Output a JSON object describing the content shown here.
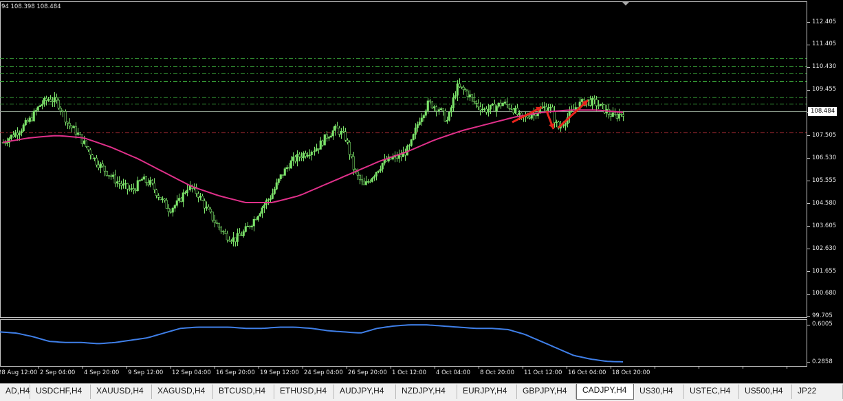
{
  "window": {
    "info_text": "94 108.398 108.484"
  },
  "price_axis": {
    "labels": [
      "112.405",
      "111.405",
      "110.430",
      "109.455",
      "108.484",
      "107.505",
      "106.530",
      "105.555",
      "104.580",
      "103.605",
      "102.630",
      "101.655",
      "100.680",
      "99.705"
    ],
    "current_price": "108.484"
  },
  "indicator_axis": {
    "top": "0.6005",
    "bottom": "0.2858"
  },
  "time_axis": {
    "labels": [
      "28 Aug 12:00",
      "2 Sep 04:00",
      "4 Sep 20:00",
      "9 Sep 12:00",
      "12 Sep 04:00",
      "16 Sep 20:00",
      "19 Sep 12:00",
      "24 Sep 04:00",
      "26 Sep 20:00",
      "1 Oct 12:00",
      "4 Oct 04:00",
      "8 Oct 20:00",
      "11 Oct 12:00",
      "16 Oct 04:00",
      "18 Oct 20:00"
    ]
  },
  "colors": {
    "candle": "#7ce36a",
    "moving_average": "#e0308a",
    "indicator_line": "#3f7fe8",
    "resistance_lines": "#3aa63a",
    "support_line": "#c0303a",
    "arrows": "#e8241c",
    "grid_frame": "#c8c8c8"
  },
  "chart_data": {
    "type": "candlestick",
    "symbol": "CADJPY",
    "timeframe": "H4",
    "ylim": [
      99.705,
      112.9
    ],
    "close_series_approx": [
      107.2,
      107.5,
      107.8,
      108.2,
      108.8,
      109.1,
      108.9,
      108.0,
      107.6,
      107.0,
      106.4,
      106.0,
      105.6,
      105.3,
      105.1,
      105.6,
      105.4,
      104.8,
      104.3,
      104.6,
      105.3,
      105.0,
      104.3,
      103.7,
      103.2,
      103.0,
      103.3,
      103.8,
      104.4,
      104.9,
      105.7,
      106.3,
      106.6,
      106.8,
      107.0,
      107.5,
      107.8,
      107.4,
      105.9,
      105.3,
      105.8,
      106.3,
      106.5,
      106.6,
      107.0,
      108.2,
      108.9,
      108.7,
      108.1,
      109.6,
      109.4,
      108.9,
      108.6,
      108.7,
      108.9,
      108.7,
      108.2,
      108.4,
      108.6,
      108.8,
      107.8,
      108.3,
      108.8,
      109.0,
      108.9,
      108.6,
      108.3,
      108.5
    ],
    "moving_average_approx": [
      107.2,
      107.4,
      107.5,
      107.4,
      107.0,
      106.5,
      105.9,
      105.3,
      104.9,
      104.6,
      104.6,
      104.9,
      105.4,
      105.9,
      106.4,
      106.8,
      107.3,
      107.7,
      108.0,
      108.3,
      108.5,
      108.6,
      108.6,
      108.5
    ],
    "horizontal_levels": {
      "resistance": [
        110.83,
        110.52,
        110.17,
        109.84,
        109.17,
        108.88
      ],
      "support": [
        107.63
      ]
    },
    "indicator": {
      "range": [
        0.2858,
        0.6005
      ],
      "values_approx": [
        0.54,
        0.53,
        0.5,
        0.46,
        0.45,
        0.45,
        0.44,
        0.45,
        0.47,
        0.49,
        0.53,
        0.57,
        0.58,
        0.58,
        0.58,
        0.57,
        0.57,
        0.58,
        0.58,
        0.57,
        0.55,
        0.54,
        0.53,
        0.57,
        0.59,
        0.6,
        0.6,
        0.59,
        0.58,
        0.57,
        0.57,
        0.56,
        0.52,
        0.46,
        0.4,
        0.34,
        0.31,
        0.29,
        0.286
      ]
    }
  },
  "tabs": [
    {
      "label": "AD,H4",
      "active": false
    },
    {
      "label": "USDCHF,H4",
      "active": false
    },
    {
      "label": "XAUUSD,H4",
      "active": false
    },
    {
      "label": "XAGUSD,H4",
      "active": false
    },
    {
      "label": "BTCUSD,H4",
      "active": false
    },
    {
      "label": "ETHUSD,H4",
      "active": false
    },
    {
      "label": "AUDJPY,H4",
      "active": false
    },
    {
      "label": "NZDJPY,H4",
      "active": false
    },
    {
      "label": "EURJPY,H4",
      "active": false
    },
    {
      "label": "GBPJPY,H4",
      "active": false
    },
    {
      "label": "CADJPY,H4",
      "active": true
    },
    {
      "label": "US30,H4",
      "active": false
    },
    {
      "label": "USTEC,H4",
      "active": false
    },
    {
      "label": "US500,H4",
      "active": false
    },
    {
      "label": "JP22",
      "active": false
    }
  ]
}
